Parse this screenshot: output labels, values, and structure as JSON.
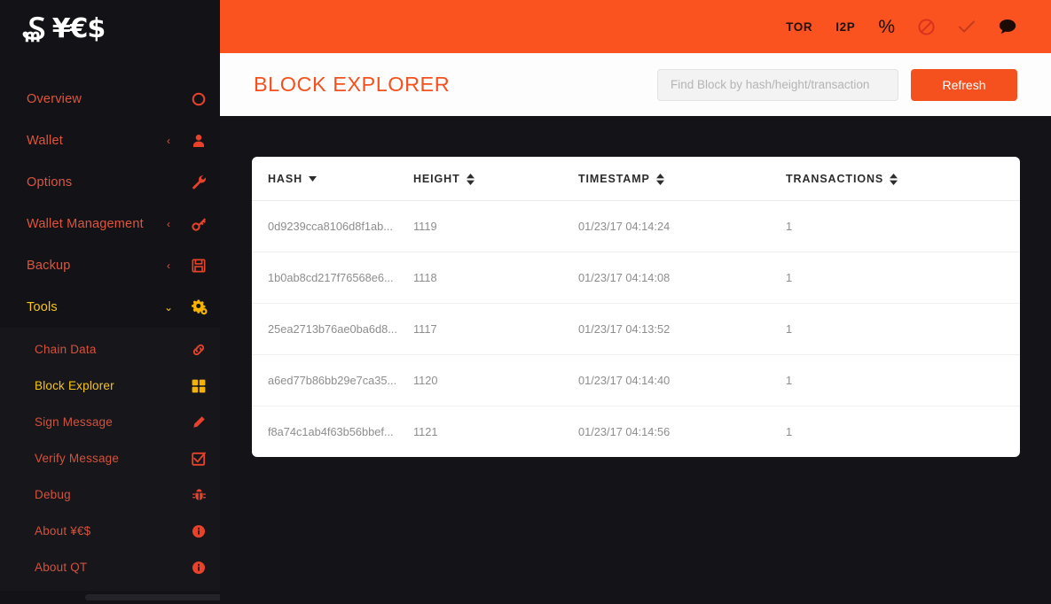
{
  "brand": {
    "mark": "₷",
    "text": "¥€$"
  },
  "sidebar": {
    "items": [
      {
        "label": "Overview",
        "icon": "circle-icon",
        "caret": "",
        "active": false
      },
      {
        "label": "Wallet",
        "icon": "user-icon",
        "caret": "‹",
        "active": false
      },
      {
        "label": "Options",
        "icon": "wrench-icon",
        "caret": "",
        "active": false
      },
      {
        "label": "Wallet Management",
        "icon": "key-icon",
        "caret": "‹",
        "active": false
      },
      {
        "label": "Backup",
        "icon": "floppy-disk-icon",
        "caret": "‹",
        "active": false
      },
      {
        "label": "Tools",
        "icon": "gears-icon",
        "caret": "⌄",
        "active": true
      }
    ],
    "submenu": [
      {
        "label": "Chain Data",
        "icon": "chain-link-icon",
        "active": false
      },
      {
        "label": "Block Explorer",
        "icon": "grid-squares-icon",
        "active": true
      },
      {
        "label": "Sign Message",
        "icon": "pencil-icon",
        "active": false
      },
      {
        "label": "Verify Message",
        "icon": "checkbox-icon",
        "active": false
      },
      {
        "label": "Debug",
        "icon": "bug-icon",
        "active": false
      },
      {
        "label": "About ¥€$",
        "icon": "info-circle-icon",
        "active": false
      },
      {
        "label": "About QT",
        "icon": "info-circle-icon",
        "active": false
      }
    ]
  },
  "topbar": {
    "items": [
      {
        "label": "TOR",
        "type": "text",
        "icon": "tor-label"
      },
      {
        "label": "I2P",
        "type": "text",
        "icon": "i2p-label"
      },
      {
        "label": "%",
        "type": "pct",
        "icon": "percent-icon"
      },
      {
        "label": "",
        "type": "icon",
        "icon": "no-entry-icon"
      },
      {
        "label": "",
        "type": "icon",
        "icon": "checkmark-icon"
      },
      {
        "label": "",
        "type": "icon",
        "icon": "chat-bubble-icon"
      }
    ]
  },
  "header": {
    "title": "BLOCK EXPLORER",
    "search_placeholder": "Find Block by hash/height/transaction",
    "search_value": "",
    "refresh_label": "Refresh"
  },
  "table": {
    "columns": [
      {
        "label": "HASH",
        "sort": "desc"
      },
      {
        "label": "HEIGHT",
        "sort": "both"
      },
      {
        "label": "TIMESTAMP",
        "sort": "both"
      },
      {
        "label": "TRANSACTIONS",
        "sort": "both"
      }
    ],
    "rows": [
      {
        "hash": "0d9239cca8106d8f1ab...",
        "height": "1119",
        "timestamp": "01/23/17 04:14:24",
        "transactions": "1"
      },
      {
        "hash": "1b0ab8cd217f76568e6...",
        "height": "1118",
        "timestamp": "01/23/17 04:14:08",
        "transactions": "1"
      },
      {
        "hash": "25ea2713b76ae0ba6d8...",
        "height": "1117",
        "timestamp": "01/23/17 04:13:52",
        "transactions": "1"
      },
      {
        "hash": "a6ed77b86bb29e7ca35...",
        "height": "1120",
        "timestamp": "01/23/17 04:14:40",
        "transactions": "1"
      },
      {
        "hash": "f8a74c1ab4f63b56bbef...",
        "height": "1121",
        "timestamp": "01/23/17 04:14:56",
        "transactions": "1"
      }
    ]
  },
  "colors": {
    "accent_orange": "#fa5320",
    "title_orange": "#f4511e",
    "nav_red": "#e0543c",
    "active_gold": "#f5c518",
    "sidebar_bg": "#131317",
    "content_bg": "#141418"
  }
}
